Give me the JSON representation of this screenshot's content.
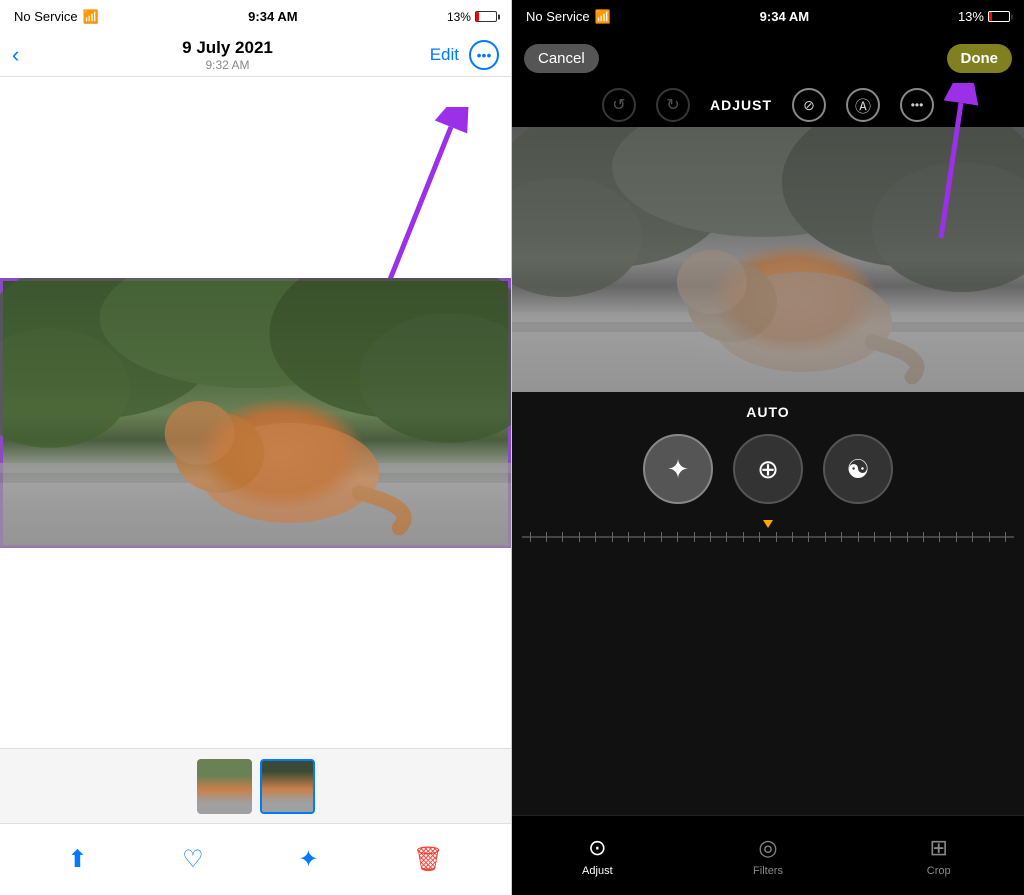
{
  "left": {
    "statusBar": {
      "signal": "No Service",
      "wifi": "📶",
      "time": "9:34 AM",
      "battery": "13%"
    },
    "navBar": {
      "title": "9 July 2021",
      "subtitle": "9:32 AM",
      "editLabel": "Edit",
      "moreIcon": "···"
    },
    "toolbar": {
      "shareIcon": "⬆",
      "heartIcon": "♡",
      "magicIcon": "✦",
      "trashIcon": "🗑"
    }
  },
  "right": {
    "statusBar": {
      "signal": "No Service",
      "wifi": "📶",
      "time": "9:34 AM",
      "battery": "13%"
    },
    "navBar": {
      "cancelLabel": "Cancel",
      "doneLabel": "Done"
    },
    "toolbar": {
      "adjustLabel": "ADJUST"
    },
    "controls": {
      "autoLabel": "AUTO"
    },
    "tabs": [
      {
        "label": "Adjust",
        "icon": "⊙"
      },
      {
        "label": "Filters",
        "icon": "◎"
      },
      {
        "label": "Crop",
        "icon": "⊞"
      }
    ]
  }
}
